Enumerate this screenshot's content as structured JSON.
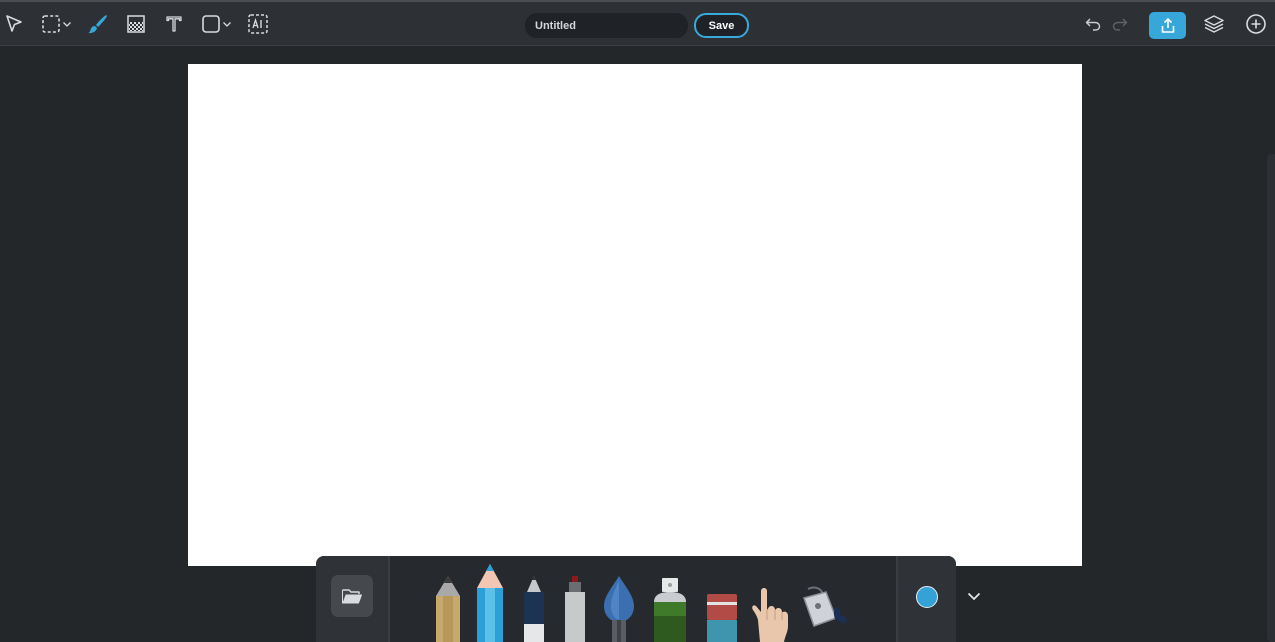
{
  "toolbar": {
    "tools": [
      {
        "name": "select-arrow-icon"
      },
      {
        "name": "marquee-selection-icon"
      },
      {
        "name": "brush-icon",
        "active": true
      },
      {
        "name": "fill-pattern-icon"
      },
      {
        "name": "text-tool-icon"
      },
      {
        "name": "shape-tool-icon"
      },
      {
        "name": "ai-tool-icon"
      }
    ],
    "title_value": "Untitled",
    "save_label": "Save",
    "right_icons": [
      "undo-icon",
      "redo-icon",
      "share-icon",
      "layers-icon",
      "add-icon"
    ]
  },
  "dock": {
    "left_icon": "folder-open-icon",
    "brushes": [
      "pencil-icon",
      "colored-pencil-icon",
      "pen-icon",
      "marker-icon",
      "watercolor-brush-icon",
      "spray-can-icon",
      "eraser-icon",
      "smudge-finger-icon",
      "fill-bucket-icon"
    ],
    "selected_brush": "colored-pencil-icon",
    "current_color": "#35a2d6",
    "expand_icon": "chevron-down-icon"
  },
  "colors": {
    "accent": "#37a7d9",
    "toolbar_bg": "#2d3034",
    "workspace_bg": "#24272a",
    "canvas_bg": "#ffffff"
  }
}
